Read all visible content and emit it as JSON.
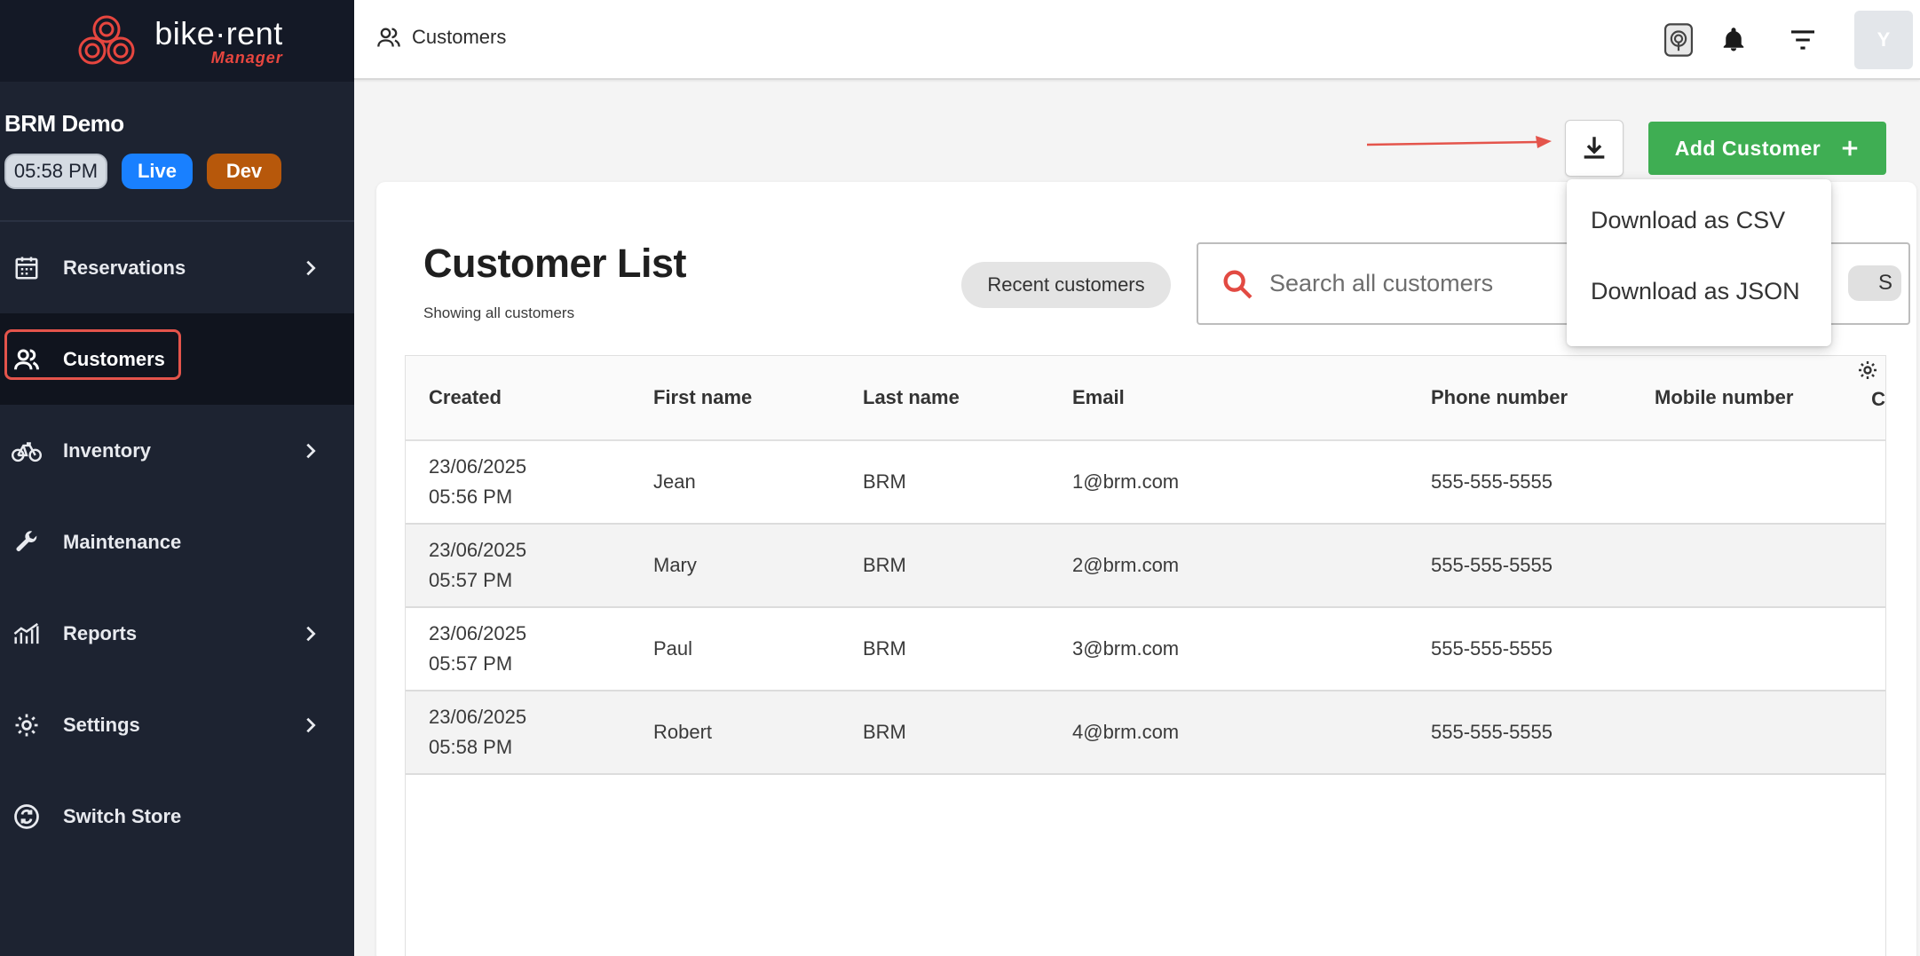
{
  "app": {
    "logo_title": "bike·rent",
    "logo_sub": "Manager",
    "store_name": "BRM Demo",
    "time": "05:58 PM",
    "live_badge": "Live",
    "dev_badge": "Dev",
    "brand_color": "#e7463f"
  },
  "sidebar": {
    "items": [
      {
        "label": "Reservations",
        "icon": "calendar-icon",
        "has_chevron": true
      },
      {
        "label": "Customers",
        "icon": "users-icon",
        "active": true
      },
      {
        "label": "Inventory",
        "icon": "bike-icon",
        "has_chevron": true
      },
      {
        "label": "Maintenance",
        "icon": "wrench-icon"
      },
      {
        "label": "Reports",
        "icon": "chart-icon",
        "has_chevron": true
      },
      {
        "label": "Settings",
        "icon": "gear-icon",
        "has_chevron": true
      },
      {
        "label": "Switch Store",
        "icon": "switch-icon"
      }
    ]
  },
  "topbar": {
    "breadcrumb": "Customers",
    "avatar_initial": "Y"
  },
  "actions": {
    "add_customer": "Add Customer",
    "add_color": "#3fae53"
  },
  "download_menu": {
    "items": [
      "Download as CSV",
      "Download as JSON"
    ]
  },
  "card": {
    "title": "Customer List",
    "subtitle": "Showing all customers",
    "recent_chip": "Recent customers",
    "search_placeholder": "Search all customers",
    "search_chip_end": "S"
  },
  "table": {
    "columns": [
      "Created",
      "First name",
      "Last name",
      "Email",
      "Phone number",
      "Mobile number"
    ],
    "cut_column": "C",
    "rows": [
      {
        "created": "23/06/2025 05:56 PM",
        "first": "Jean",
        "last": "BRM",
        "email": "1@brm.com",
        "phone": "555-555-5555",
        "mobile": ""
      },
      {
        "created": "23/06/2025 05:57 PM",
        "first": "Mary",
        "last": "BRM",
        "email": "2@brm.com",
        "phone": "555-555-5555",
        "mobile": ""
      },
      {
        "created": "23/06/2025 05:57 PM",
        "first": "Paul",
        "last": "BRM",
        "email": "3@brm.com",
        "phone": "555-555-5555",
        "mobile": ""
      },
      {
        "created": "23/06/2025 05:58 PM",
        "first": "Robert",
        "last": "BRM",
        "email": "4@brm.com",
        "phone": "555-555-5555",
        "mobile": ""
      }
    ]
  }
}
